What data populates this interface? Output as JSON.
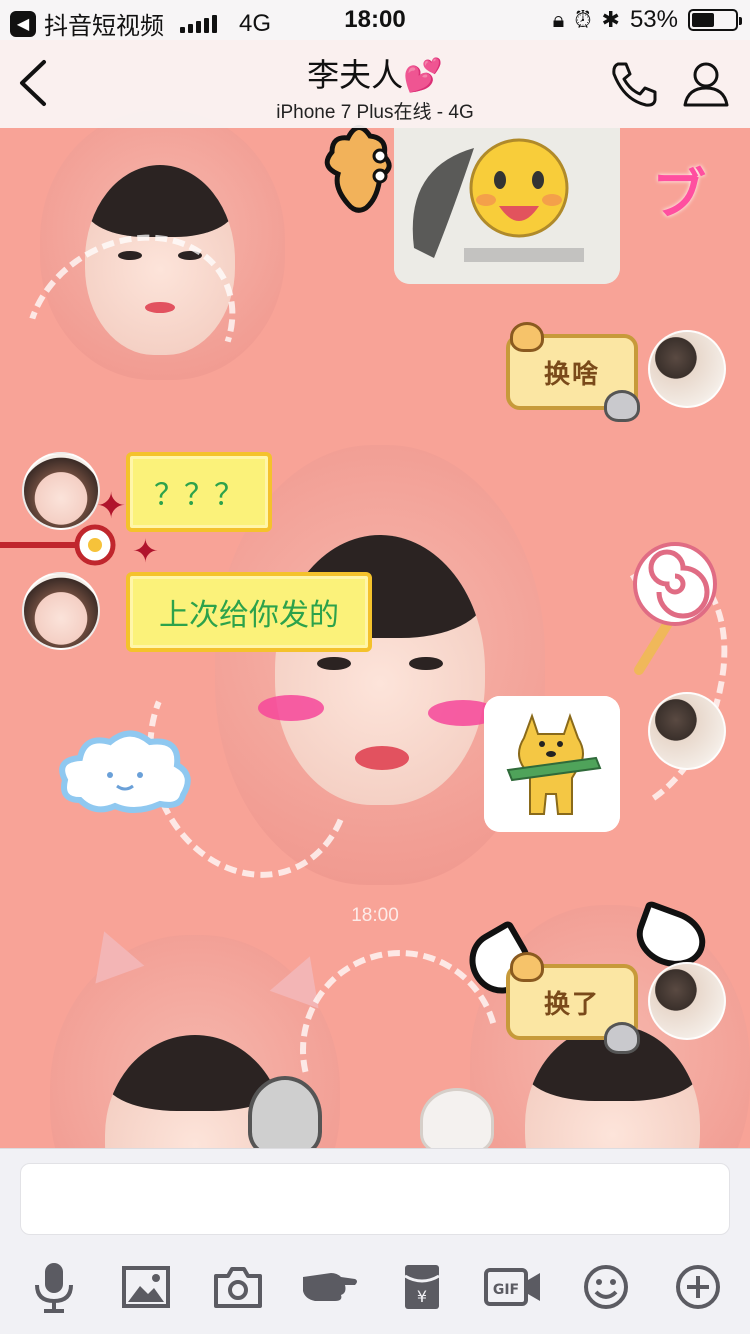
{
  "status_bar": {
    "back_app": "抖音短视频",
    "network": "4G",
    "time": "18:00",
    "battery": "53%",
    "battery_level": 0.53
  },
  "nav": {
    "title": "李夫人💕",
    "subtitle": "iPhone 7 Plus在线 - 4G"
  },
  "messages": [
    {
      "from": "them",
      "type": "text",
      "text": "？？？"
    },
    {
      "from": "them",
      "type": "text",
      "text": "上次给你发的"
    },
    {
      "from": "me",
      "type": "sticker",
      "text": "换啥"
    },
    {
      "from": "me",
      "type": "sticker",
      "text": "换了"
    }
  ],
  "timestamp": "18:00",
  "input": {
    "value": "",
    "placeholder": ""
  },
  "toolbar": [
    "microphone-icon",
    "image-icon",
    "camera-icon",
    "poke-icon",
    "red-packet-icon",
    "gif-icon",
    "emoji-icon",
    "plus-icon"
  ],
  "colors": {
    "chat_bg": "#f8a397",
    "bubble_yellow": "#fbf27a",
    "bubble_text": "#2ca24b"
  }
}
